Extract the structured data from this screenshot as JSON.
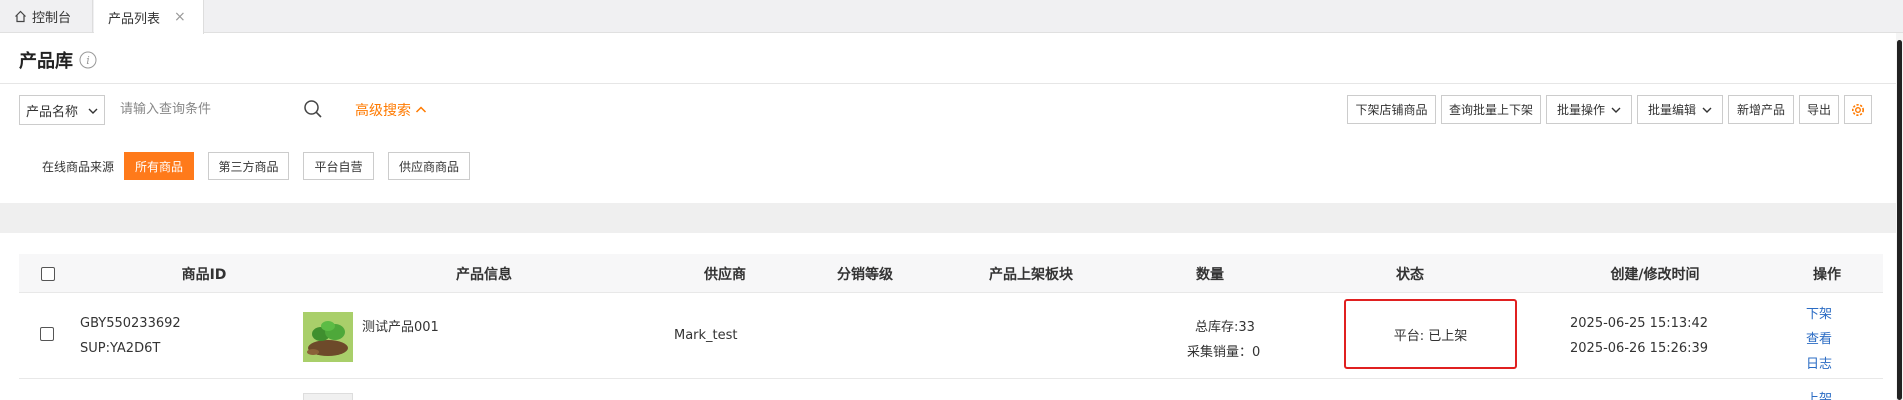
{
  "tabs": {
    "home_label": "控制台",
    "active_label": "产品列表",
    "close_glyph": "×"
  },
  "page": {
    "title": "产品库",
    "info_glyph": "i"
  },
  "search": {
    "field_select": "产品名称",
    "placeholder": "请输入查询条件",
    "advanced_label": "高级搜索",
    "accent_color": "#ff7a00"
  },
  "toolbar": {
    "delist_store": "下架店铺商品",
    "batch_query_listing": "查询批量上下架",
    "batch_ops": "批量操作",
    "batch_edit": "批量编辑",
    "add_product": "新增产品",
    "export": "导出",
    "settings_icon": "gear-icon"
  },
  "filters": {
    "label": "在线商品来源",
    "options": [
      "所有商品",
      "第三方商品",
      "平台自营",
      "供应商商品"
    ],
    "active_index": 0
  },
  "table": {
    "headers": [
      "商品ID",
      "产品信息",
      "供应商",
      "分销等级",
      "产品上架板块",
      "数量",
      "状态",
      "创建/修改时间",
      "操作"
    ],
    "rows": [
      {
        "id": "GBY550233692",
        "sup": "SUP:YA2D6T",
        "product_name": "测试产品001",
        "supplier": "Mark_test",
        "distribution_level": "",
        "listing_section": "",
        "stock": "总库存:33",
        "sales": "采集销量：0",
        "status": "平台: 已上架",
        "created": "2025-06-25 15:13:42",
        "modified": "2025-06-26 15:26:39",
        "actions": [
          "下架",
          "查看",
          "日志"
        ]
      }
    ],
    "next_row_action": "上架"
  }
}
